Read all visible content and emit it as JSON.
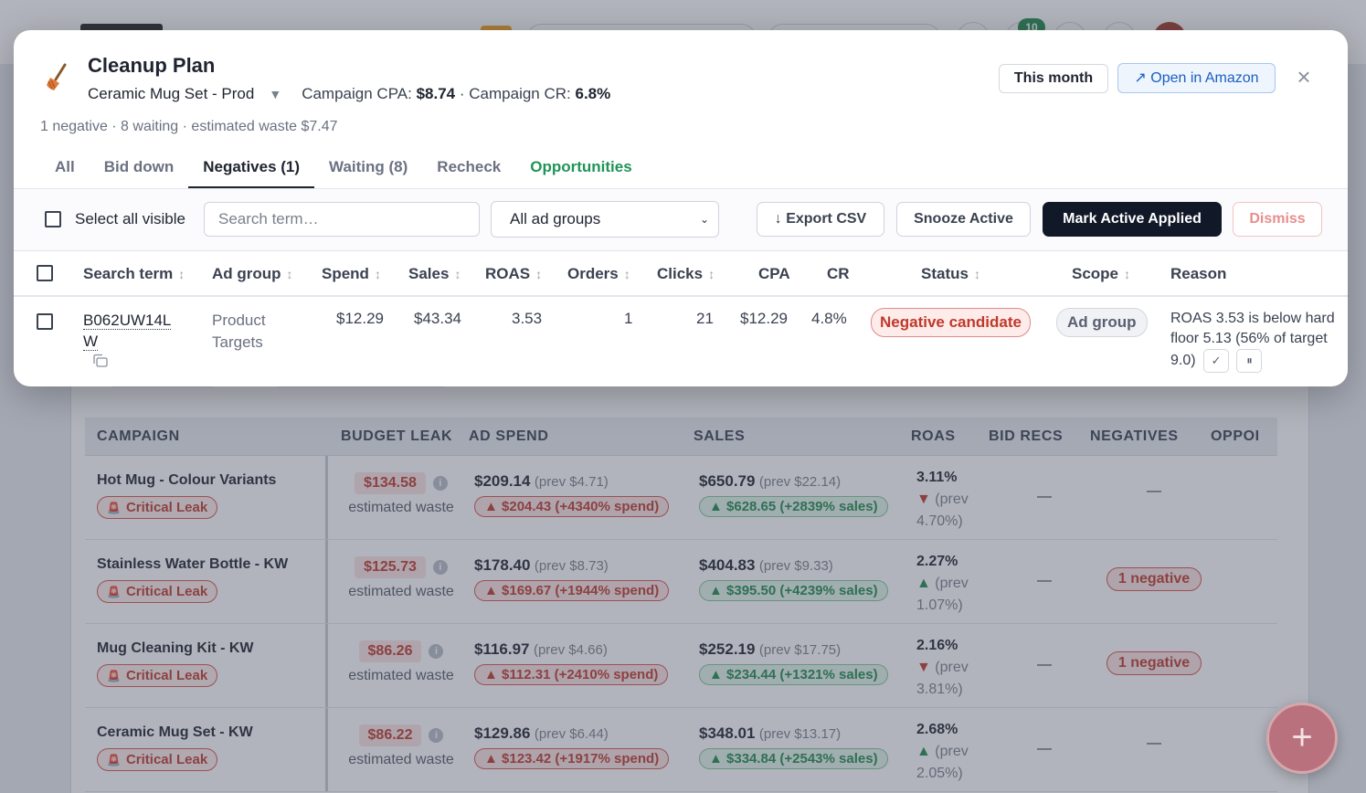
{
  "colors": {
    "accent_dark": "#111827",
    "link_blue": "#1a5fc2",
    "danger": "#c0392b",
    "success": "#1f8a4c",
    "opportunity_green": "#1f9456"
  },
  "background": {
    "notification_count": "10",
    "campaign_table": {
      "headers": [
        "CAMPAIGN",
        "BUDGET LEAK",
        "AD SPEND",
        "SALES",
        "ROAS",
        "BID RECS",
        "NEGATIVES",
        "OPPOI"
      ],
      "rows": [
        {
          "name": "Hot Mug - Colour Variants",
          "leak_label": "Critical Leak",
          "waste": "$134.58",
          "waste_label": "estimated waste",
          "spend": "$209.14",
          "spend_prev": "(prev $4.71)",
          "spend_delta": "▲ $204.43 (+4340% spend)",
          "sales": "$650.79",
          "sales_prev": "(prev $22.14)",
          "sales_delta": "▲ $628.65 (+2839% sales)",
          "roas": "3.11%",
          "roas_dir": "down",
          "roas_prev_label": "(prev",
          "roas_prev_val": "4.70%)",
          "bid_recs": "—",
          "negatives": "—"
        },
        {
          "name": "Stainless Water Bottle - KW",
          "leak_label": "Critical Leak",
          "waste": "$125.73",
          "waste_label": "estimated waste",
          "spend": "$178.40",
          "spend_prev": "(prev $8.73)",
          "spend_delta": "▲ $169.67 (+1944% spend)",
          "sales": "$404.83",
          "sales_prev": "(prev $9.33)",
          "sales_delta": "▲ $395.50 (+4239% sales)",
          "roas": "2.27%",
          "roas_dir": "up",
          "roas_prev_label": "(prev",
          "roas_prev_val": "1.07%)",
          "bid_recs": "—",
          "negatives": "1 negative"
        },
        {
          "name": "Mug Cleaning Kit - KW",
          "leak_label": "Critical Leak",
          "waste": "$86.26",
          "waste_label": "estimated waste",
          "spend": "$116.97",
          "spend_prev": "(prev $4.66)",
          "spend_delta": "▲ $112.31 (+2410% spend)",
          "sales": "$252.19",
          "sales_prev": "(prev $17.75)",
          "sales_delta": "▲ $234.44 (+1321% sales)",
          "roas": "2.16%",
          "roas_dir": "down",
          "roas_prev_label": "(prev",
          "roas_prev_val": "3.81%)",
          "bid_recs": "—",
          "negatives": "1 negative"
        },
        {
          "name": "Ceramic Mug Set - KW",
          "leak_label": "Critical Leak",
          "waste": "$86.22",
          "waste_label": "estimated waste",
          "spend": "$129.86",
          "spend_prev": "(prev $6.44)",
          "spend_delta": "▲ $123.42 (+1917% spend)",
          "sales": "$348.01",
          "sales_prev": "(prev $13.17)",
          "sales_delta": "▲ $334.84 (+2543% sales)",
          "roas": "2.68%",
          "roas_dir": "up",
          "roas_prev_label": "(prev",
          "roas_prev_val": "2.05%)",
          "bid_recs": "—",
          "negatives": "—"
        }
      ]
    },
    "fab_label": "+"
  },
  "modal": {
    "icon": "broom-icon",
    "title": "Cleanup Plan",
    "campaign_name": "Ceramic Mug Set - Prod",
    "caret": "▼",
    "cpa_label": "Campaign CPA:",
    "cpa_value": "$8.74",
    "separator": "·",
    "cr_label": "Campaign CR:",
    "cr_value": "6.8%",
    "summary": "1 negative · 8 waiting · estimated waste $7.47",
    "period_button": "This month",
    "amazon_button": "↗ Open in Amazon",
    "close_label": "×",
    "tabs": [
      {
        "label": "All",
        "active": false
      },
      {
        "label": "Bid down",
        "active": false
      },
      {
        "label": "Negatives (1)",
        "active": true
      },
      {
        "label": "Waiting (8)",
        "active": false
      },
      {
        "label": "Recheck",
        "active": false
      },
      {
        "label": "Opportunities",
        "active": false
      }
    ],
    "toolbar": {
      "select_all_label": "Select all visible",
      "search_placeholder": "Search term…",
      "adgroup_filter": "All ad groups",
      "export_label": "↓ Export CSV",
      "snooze_label": "Snooze Active",
      "mark_applied_label": "Mark Active Applied",
      "dismiss_label": "Dismiss"
    },
    "table": {
      "headers": {
        "search_term": "Search term",
        "ad_group": "Ad group",
        "spend": "Spend",
        "sales": "Sales",
        "roas": "ROAS",
        "orders": "Orders",
        "clicks": "Clicks",
        "cpa": "CPA",
        "cr": "CR",
        "status": "Status",
        "scope": "Scope",
        "reason": "Reason"
      },
      "sort_glyph": "↕",
      "rows": [
        {
          "term_line1": "B062UW14L",
          "term_line2": "W",
          "ad_group_line1": "Product",
          "ad_group_line2": "Targets",
          "spend": "$12.29",
          "sales": "$43.34",
          "roas": "3.53",
          "orders": "1",
          "clicks": "21",
          "cpa": "$12.29",
          "cr": "4.8%",
          "status": "Negative candidate",
          "scope": "Ad group",
          "reason": "ROAS 3.53 is below hard floor 5.13 (56% of target 9.0)",
          "approve_glyph": "✓",
          "pause_glyph": "⏸"
        }
      ]
    }
  }
}
